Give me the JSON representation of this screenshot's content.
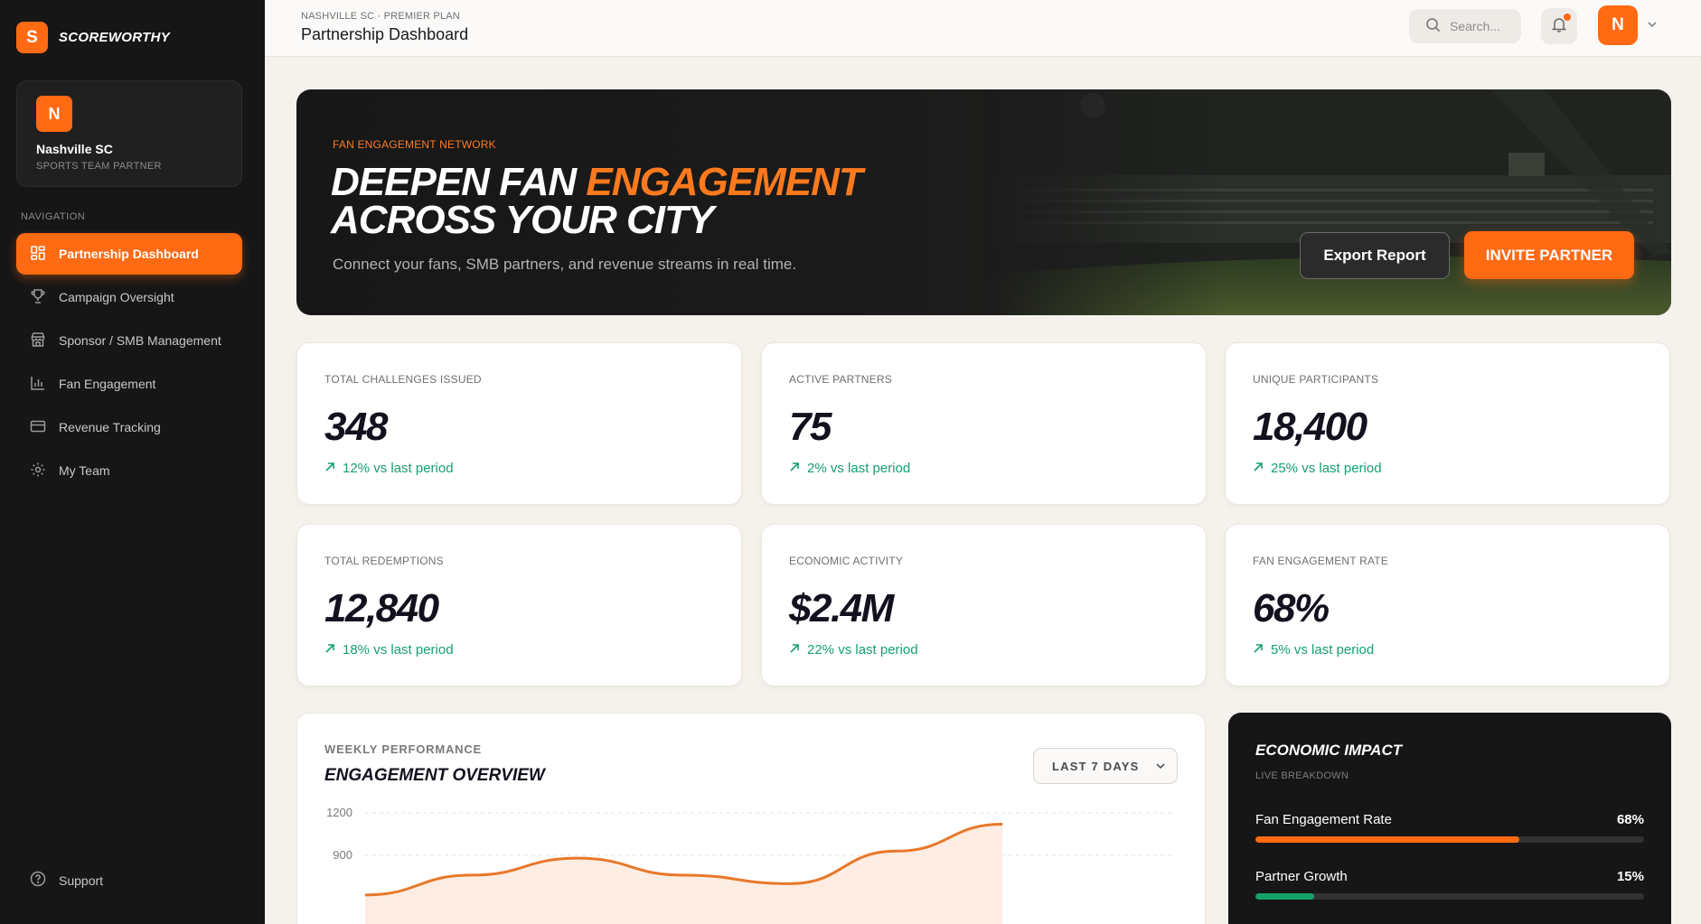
{
  "brand": {
    "logo_letter": "S",
    "name": "SCOREWORTHY"
  },
  "team": {
    "avatar_letter": "N",
    "name": "Nashville SC",
    "subtitle": "SPORTS TEAM PARTNER"
  },
  "sidebar": {
    "heading": "NAVIGATION",
    "items": [
      {
        "label": "Partnership Dashboard",
        "icon": "dashboard-grid-icon",
        "active": true
      },
      {
        "label": "Campaign Oversight",
        "icon": "trophy-icon",
        "active": false
      },
      {
        "label": "Sponsor / SMB Management",
        "icon": "store-icon",
        "active": false
      },
      {
        "label": "Fan Engagement",
        "icon": "bar-chart-icon",
        "active": false
      },
      {
        "label": "Revenue Tracking",
        "icon": "credit-card-icon",
        "active": false
      },
      {
        "label": "My Team",
        "icon": "gear-icon",
        "active": false
      }
    ],
    "support_label": "Support"
  },
  "header": {
    "breadcrumb": "NASHVILLE SC · PREMIER PLAN",
    "title": "Partnership Dashboard",
    "search_placeholder": "Search...",
    "user_initial": "N"
  },
  "hero": {
    "eyebrow": "FAN ENGAGEMENT NETWORK",
    "title_part1": "DEEPEN FAN ",
    "title_accent": "ENGAGEMENT",
    "title_line2": "ACROSS YOUR CITY",
    "subtitle": "Connect your fans, SMB partners, and revenue streams in real time.",
    "export_label": "Export Report",
    "invite_label": "INVITE PARTNER"
  },
  "stats": [
    {
      "label": "TOTAL CHALLENGES ISSUED",
      "value": "348",
      "delta": "12% vs last period"
    },
    {
      "label": "ACTIVE PARTNERS",
      "value": "75",
      "delta": "2% vs last period"
    },
    {
      "label": "UNIQUE PARTICIPANTS",
      "value": "18,400",
      "delta": "25% vs last period"
    },
    {
      "label": "TOTAL REDEMPTIONS",
      "value": "12,840",
      "delta": "18% vs last period"
    },
    {
      "label": "ECONOMIC ACTIVITY",
      "value": "$2.4M",
      "delta": "22% vs last period"
    },
    {
      "label": "FAN ENGAGEMENT RATE",
      "value": "68%",
      "delta": "5% vs last period"
    }
  ],
  "weekly": {
    "eyebrow": "WEEKLY PERFORMANCE",
    "title": "ENGAGEMENT OVERVIEW",
    "range_label": "LAST 7 DAYS"
  },
  "chart_data": {
    "type": "area",
    "title": "ENGAGEMENT OVERVIEW",
    "ylim": [
      0,
      1200
    ],
    "yticks": [
      "1200",
      "900"
    ],
    "x": [
      0,
      1,
      2,
      3,
      4,
      5,
      6
    ],
    "values": [
      620,
      760,
      880,
      760,
      700,
      930,
      1120
    ],
    "grid": true,
    "color": "#e8782a"
  },
  "impact": {
    "title": "ECONOMIC IMPACT",
    "subtitle": "LIVE BREAKDOWN",
    "metrics": [
      {
        "label": "Fan Engagement Rate",
        "value_text": "68%",
        "fraction": 0.68,
        "color": "#ff6a13"
      },
      {
        "label": "Partner Growth",
        "value_text": "15%",
        "fraction": 0.15,
        "color": "#16a06c"
      }
    ]
  },
  "colors": {
    "accent": "#ff6a13",
    "positive": "#16a06c",
    "sidebar_bg": "#161616"
  }
}
